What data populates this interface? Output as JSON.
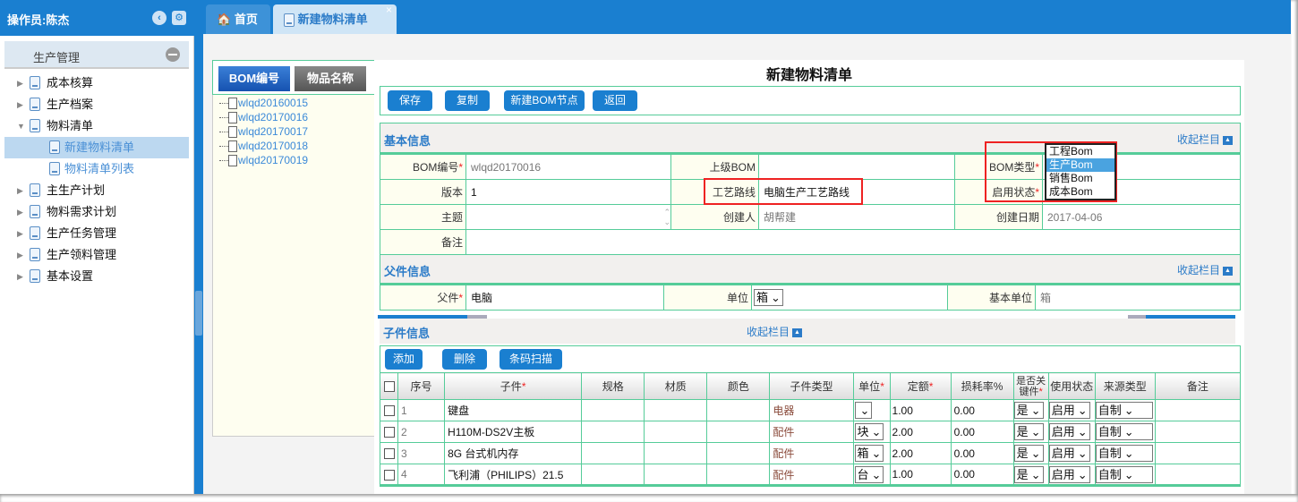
{
  "sidebar": {
    "operator": "操作员:陈杰",
    "group": "生产管理",
    "items": [
      {
        "label": "成本核算"
      },
      {
        "label": "生产档案"
      },
      {
        "label": "物料清单"
      },
      {
        "label": "新建物料清单"
      },
      {
        "label": "物料清单列表"
      },
      {
        "label": "主生产计划"
      },
      {
        "label": "物料需求计划"
      },
      {
        "label": "生产任务管理"
      },
      {
        "label": "生产领料管理"
      },
      {
        "label": "基本设置"
      }
    ]
  },
  "tabs": [
    {
      "label": "首页"
    },
    {
      "label": "新建物料清单",
      "close": "×"
    }
  ],
  "left_panel": {
    "tab_bom": "BOM编号",
    "tab_name": "物品名称",
    "tree": [
      "wlqd20160015",
      "wlqd20170016",
      "wlqd20170017",
      "wlqd20170018",
      "wlqd20170019"
    ]
  },
  "form": {
    "title": "新建物料清单",
    "toolbar": {
      "save": "保存",
      "copy": "复制",
      "new_node": "新建BOM节点",
      "back": "返回"
    },
    "collapse": "收起栏目",
    "basic": {
      "title": "基本信息",
      "bom_no_label": "BOM编号",
      "bom_no": "wlqd20170016",
      "parent_bom_label": "上级BOM",
      "parent_bom": "",
      "bom_type_label": "BOM类型",
      "version_label": "版本",
      "version": "1",
      "route_label": "工艺路线",
      "route": "电脑生产工艺路线",
      "status_label": "启用状态",
      "subject_label": "主题",
      "creator_label": "创建人",
      "creator": "胡帮建",
      "date_label": "创建日期",
      "date": "2017-04-06",
      "remark_label": "备注",
      "bom_type_options": [
        "工程Bom",
        "生产Bom",
        "销售Bom",
        "成本Bom"
      ],
      "bom_type_selected": "生产Bom"
    },
    "parent": {
      "title": "父件信息",
      "parent_label": "父件",
      "parent": "电脑",
      "unit_label": "单位",
      "unit": "箱",
      "base_unit_label": "基本单位",
      "base_unit": "箱"
    },
    "child": {
      "title": "子件信息",
      "add": "添加",
      "delete": "删除",
      "scan": "条码扫描",
      "columns": [
        "序号",
        "子件",
        "规格",
        "材质",
        "颜色",
        "子件类型",
        "单位",
        "定额",
        "损耗率%",
        "是否关键件",
        "使用状态",
        "来源类型",
        "备注"
      ],
      "rows": [
        {
          "no": "1",
          "item": "键盘",
          "type": "电器",
          "unit": "",
          "qty": "1.00",
          "loss": "0.00",
          "key": "是",
          "status": "启用",
          "source": "自制"
        },
        {
          "no": "2",
          "item": "H110M-DS2V主板",
          "type": "配件",
          "unit": "块",
          "qty": "2.00",
          "loss": "0.00",
          "key": "是",
          "status": "启用",
          "source": "自制"
        },
        {
          "no": "3",
          "item": "8G 台式机内存",
          "type": "配件",
          "unit": "箱",
          "qty": "2.00",
          "loss": "0.00",
          "key": "是",
          "status": "启用",
          "source": "自制"
        },
        {
          "no": "4",
          "item": "飞利浦（PHILIPS）21.5",
          "type": "配件",
          "unit": "台",
          "qty": "1.00",
          "loss": "0.00",
          "key": "是",
          "status": "启用",
          "source": "自制"
        }
      ]
    }
  },
  "colors": {
    "primary": "#1a7fd0",
    "border": "#55cc99",
    "required": "#ee2222",
    "highlight": "#e22222"
  }
}
